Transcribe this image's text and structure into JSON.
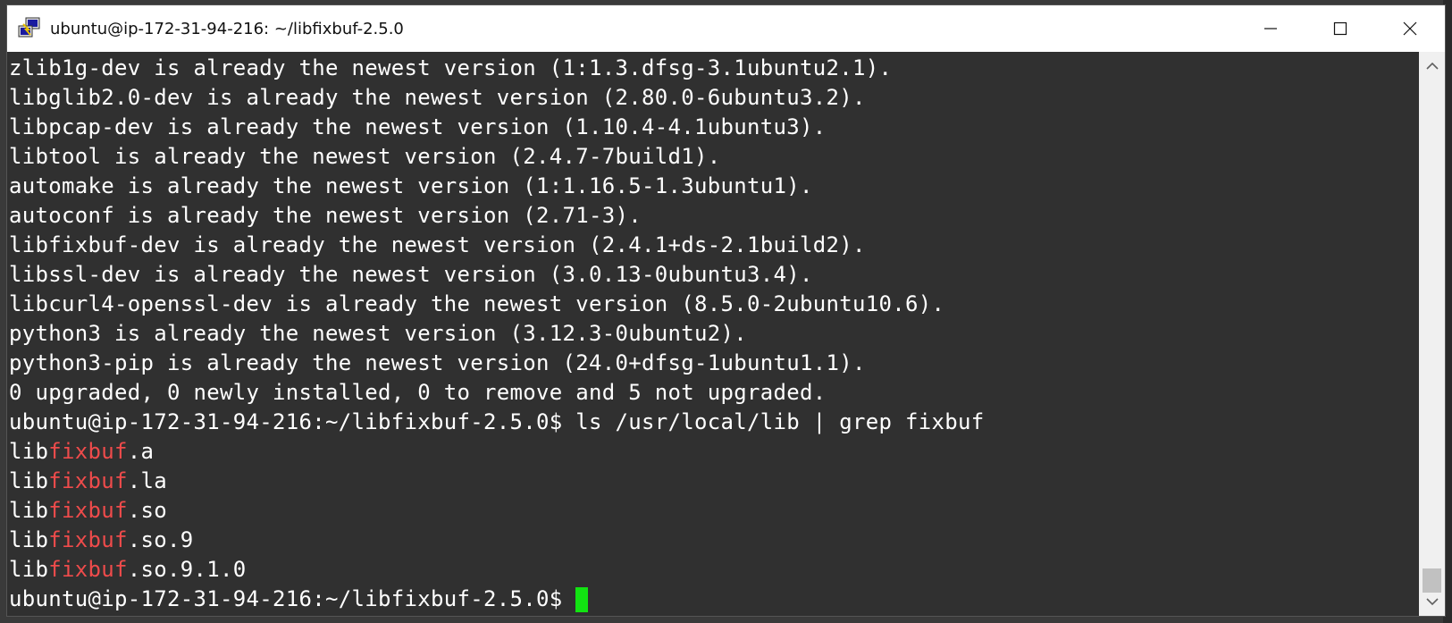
{
  "window": {
    "title": "ubuntu@ip-172-31-94-216: ~/libfixbuf-2.5.0"
  },
  "terminal": {
    "lines": [
      "zlib1g-dev is already the newest version (1:1.3.dfsg-3.1ubuntu2.1).",
      "libglib2.0-dev is already the newest version (2.80.0-6ubuntu3.2).",
      "libpcap-dev is already the newest version (1.10.4-4.1ubuntu3).",
      "libtool is already the newest version (2.4.7-7build1).",
      "automake is already the newest version (1:1.16.5-1.3ubuntu1).",
      "autoconf is already the newest version (2.71-3).",
      "libfixbuf-dev is already the newest version (2.4.1+ds-2.1build2).",
      "libssl-dev is already the newest version (3.0.13-0ubuntu3.4).",
      "libcurl4-openssl-dev is already the newest version (8.5.0-2ubuntu10.6).",
      "python3 is already the newest version (3.12.3-0ubuntu2).",
      "python3-pip is already the newest version (24.0+dfsg-1ubuntu1.1).",
      "0 upgraded, 0 newly installed, 0 to remove and 5 not upgraded.",
      "ubuntu@ip-172-31-94-216:~/libfixbuf-2.5.0$ ls /usr/local/lib | grep fixbuf"
    ],
    "grep_results": [
      {
        "prefix": "lib",
        "match": "fixbuf",
        "suffix": ".a"
      },
      {
        "prefix": "lib",
        "match": "fixbuf",
        "suffix": ".la"
      },
      {
        "prefix": "lib",
        "match": "fixbuf",
        "suffix": ".so"
      },
      {
        "prefix": "lib",
        "match": "fixbuf",
        "suffix": ".so.9"
      },
      {
        "prefix": "lib",
        "match": "fixbuf",
        "suffix": ".so.9.1.0"
      }
    ],
    "prompt": "ubuntu@ip-172-31-94-216:~/libfixbuf-2.5.0$ ",
    "colors": {
      "background": "#303030",
      "text": "#ffffff",
      "grep_highlight": "#ef4b4b",
      "cursor": "#12e312"
    }
  },
  "icons": {
    "app": "putty-icon",
    "minimize": "minimize-icon",
    "maximize": "maximize-icon",
    "close": "close-icon",
    "scroll_up": "scroll-up-icon",
    "scroll_down": "scroll-down-icon"
  }
}
